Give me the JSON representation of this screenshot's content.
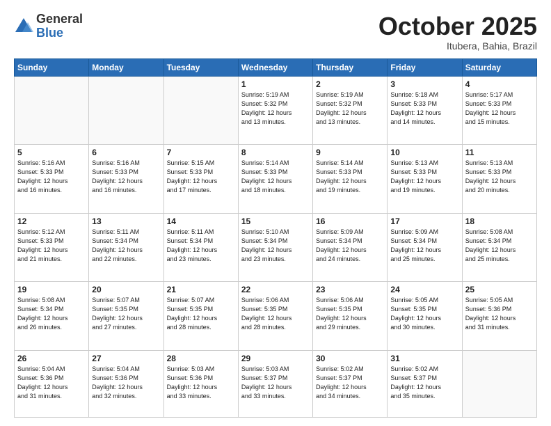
{
  "header": {
    "logo_general": "General",
    "logo_blue": "Blue",
    "month_title": "October 2025",
    "location": "Itubera, Bahia, Brazil"
  },
  "days_of_week": [
    "Sunday",
    "Monday",
    "Tuesday",
    "Wednesday",
    "Thursday",
    "Friday",
    "Saturday"
  ],
  "weeks": [
    [
      {
        "day": "",
        "info": ""
      },
      {
        "day": "",
        "info": ""
      },
      {
        "day": "",
        "info": ""
      },
      {
        "day": "1",
        "info": "Sunrise: 5:19 AM\nSunset: 5:32 PM\nDaylight: 12 hours\nand 13 minutes."
      },
      {
        "day": "2",
        "info": "Sunrise: 5:19 AM\nSunset: 5:32 PM\nDaylight: 12 hours\nand 13 minutes."
      },
      {
        "day": "3",
        "info": "Sunrise: 5:18 AM\nSunset: 5:33 PM\nDaylight: 12 hours\nand 14 minutes."
      },
      {
        "day": "4",
        "info": "Sunrise: 5:17 AM\nSunset: 5:33 PM\nDaylight: 12 hours\nand 15 minutes."
      }
    ],
    [
      {
        "day": "5",
        "info": "Sunrise: 5:16 AM\nSunset: 5:33 PM\nDaylight: 12 hours\nand 16 minutes."
      },
      {
        "day": "6",
        "info": "Sunrise: 5:16 AM\nSunset: 5:33 PM\nDaylight: 12 hours\nand 16 minutes."
      },
      {
        "day": "7",
        "info": "Sunrise: 5:15 AM\nSunset: 5:33 PM\nDaylight: 12 hours\nand 17 minutes."
      },
      {
        "day": "8",
        "info": "Sunrise: 5:14 AM\nSunset: 5:33 PM\nDaylight: 12 hours\nand 18 minutes."
      },
      {
        "day": "9",
        "info": "Sunrise: 5:14 AM\nSunset: 5:33 PM\nDaylight: 12 hours\nand 19 minutes."
      },
      {
        "day": "10",
        "info": "Sunrise: 5:13 AM\nSunset: 5:33 PM\nDaylight: 12 hours\nand 19 minutes."
      },
      {
        "day": "11",
        "info": "Sunrise: 5:13 AM\nSunset: 5:33 PM\nDaylight: 12 hours\nand 20 minutes."
      }
    ],
    [
      {
        "day": "12",
        "info": "Sunrise: 5:12 AM\nSunset: 5:33 PM\nDaylight: 12 hours\nand 21 minutes."
      },
      {
        "day": "13",
        "info": "Sunrise: 5:11 AM\nSunset: 5:34 PM\nDaylight: 12 hours\nand 22 minutes."
      },
      {
        "day": "14",
        "info": "Sunrise: 5:11 AM\nSunset: 5:34 PM\nDaylight: 12 hours\nand 23 minutes."
      },
      {
        "day": "15",
        "info": "Sunrise: 5:10 AM\nSunset: 5:34 PM\nDaylight: 12 hours\nand 23 minutes."
      },
      {
        "day": "16",
        "info": "Sunrise: 5:09 AM\nSunset: 5:34 PM\nDaylight: 12 hours\nand 24 minutes."
      },
      {
        "day": "17",
        "info": "Sunrise: 5:09 AM\nSunset: 5:34 PM\nDaylight: 12 hours\nand 25 minutes."
      },
      {
        "day": "18",
        "info": "Sunrise: 5:08 AM\nSunset: 5:34 PM\nDaylight: 12 hours\nand 25 minutes."
      }
    ],
    [
      {
        "day": "19",
        "info": "Sunrise: 5:08 AM\nSunset: 5:34 PM\nDaylight: 12 hours\nand 26 minutes."
      },
      {
        "day": "20",
        "info": "Sunrise: 5:07 AM\nSunset: 5:35 PM\nDaylight: 12 hours\nand 27 minutes."
      },
      {
        "day": "21",
        "info": "Sunrise: 5:07 AM\nSunset: 5:35 PM\nDaylight: 12 hours\nand 28 minutes."
      },
      {
        "day": "22",
        "info": "Sunrise: 5:06 AM\nSunset: 5:35 PM\nDaylight: 12 hours\nand 28 minutes."
      },
      {
        "day": "23",
        "info": "Sunrise: 5:06 AM\nSunset: 5:35 PM\nDaylight: 12 hours\nand 29 minutes."
      },
      {
        "day": "24",
        "info": "Sunrise: 5:05 AM\nSunset: 5:35 PM\nDaylight: 12 hours\nand 30 minutes."
      },
      {
        "day": "25",
        "info": "Sunrise: 5:05 AM\nSunset: 5:36 PM\nDaylight: 12 hours\nand 31 minutes."
      }
    ],
    [
      {
        "day": "26",
        "info": "Sunrise: 5:04 AM\nSunset: 5:36 PM\nDaylight: 12 hours\nand 31 minutes."
      },
      {
        "day": "27",
        "info": "Sunrise: 5:04 AM\nSunset: 5:36 PM\nDaylight: 12 hours\nand 32 minutes."
      },
      {
        "day": "28",
        "info": "Sunrise: 5:03 AM\nSunset: 5:36 PM\nDaylight: 12 hours\nand 33 minutes."
      },
      {
        "day": "29",
        "info": "Sunrise: 5:03 AM\nSunset: 5:37 PM\nDaylight: 12 hours\nand 33 minutes."
      },
      {
        "day": "30",
        "info": "Sunrise: 5:02 AM\nSunset: 5:37 PM\nDaylight: 12 hours\nand 34 minutes."
      },
      {
        "day": "31",
        "info": "Sunrise: 5:02 AM\nSunset: 5:37 PM\nDaylight: 12 hours\nand 35 minutes."
      },
      {
        "day": "",
        "info": ""
      }
    ]
  ]
}
